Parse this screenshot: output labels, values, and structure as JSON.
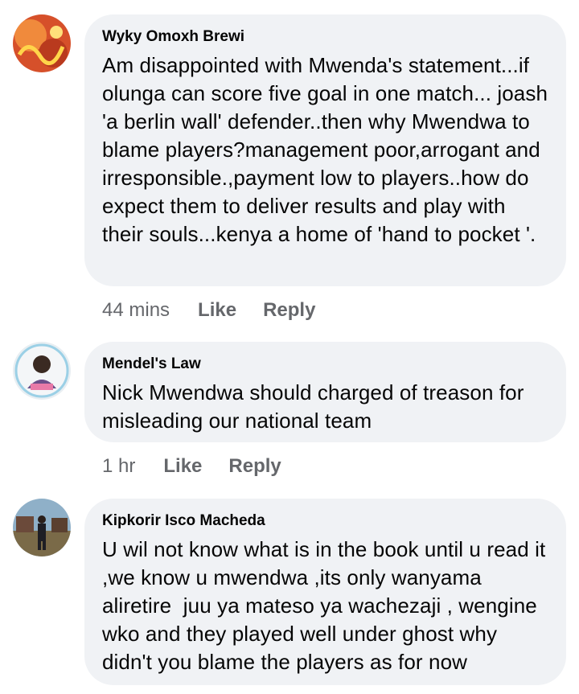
{
  "comments": [
    {
      "author": "Wyky Omoxh Brewi",
      "text": "Am disappointed with Mwenda's statement...if olunga can score five goal in one match... joash 'a berlin wall' defender..then why Mwendwa to blame players?management poor,arrogant and irresponsible.,payment low to players..how do expect them to deliver results and play with their souls...kenya a home of 'hand to pocket '.",
      "time": "44 mins",
      "like": "Like",
      "reply": "Reply"
    },
    {
      "author": "Mendel's Law",
      "text": "Nick Mwendwa should charged of treason for misleading our national team",
      "time": "1 hr",
      "like": "Like",
      "reply": "Reply"
    },
    {
      "author": "Kipkorir Isco Macheda",
      "text": "U wil not know what is in the book until u read it ,we know u mwendwa ,its only wanyama aliretire  juu ya mateso ya wachezaji , wengine wko and they played well under ghost why didn't you blame the players as for now"
    }
  ],
  "colors": {
    "bubble": "#f0f2f5",
    "meta": "#65676b",
    "text": "#050505"
  }
}
